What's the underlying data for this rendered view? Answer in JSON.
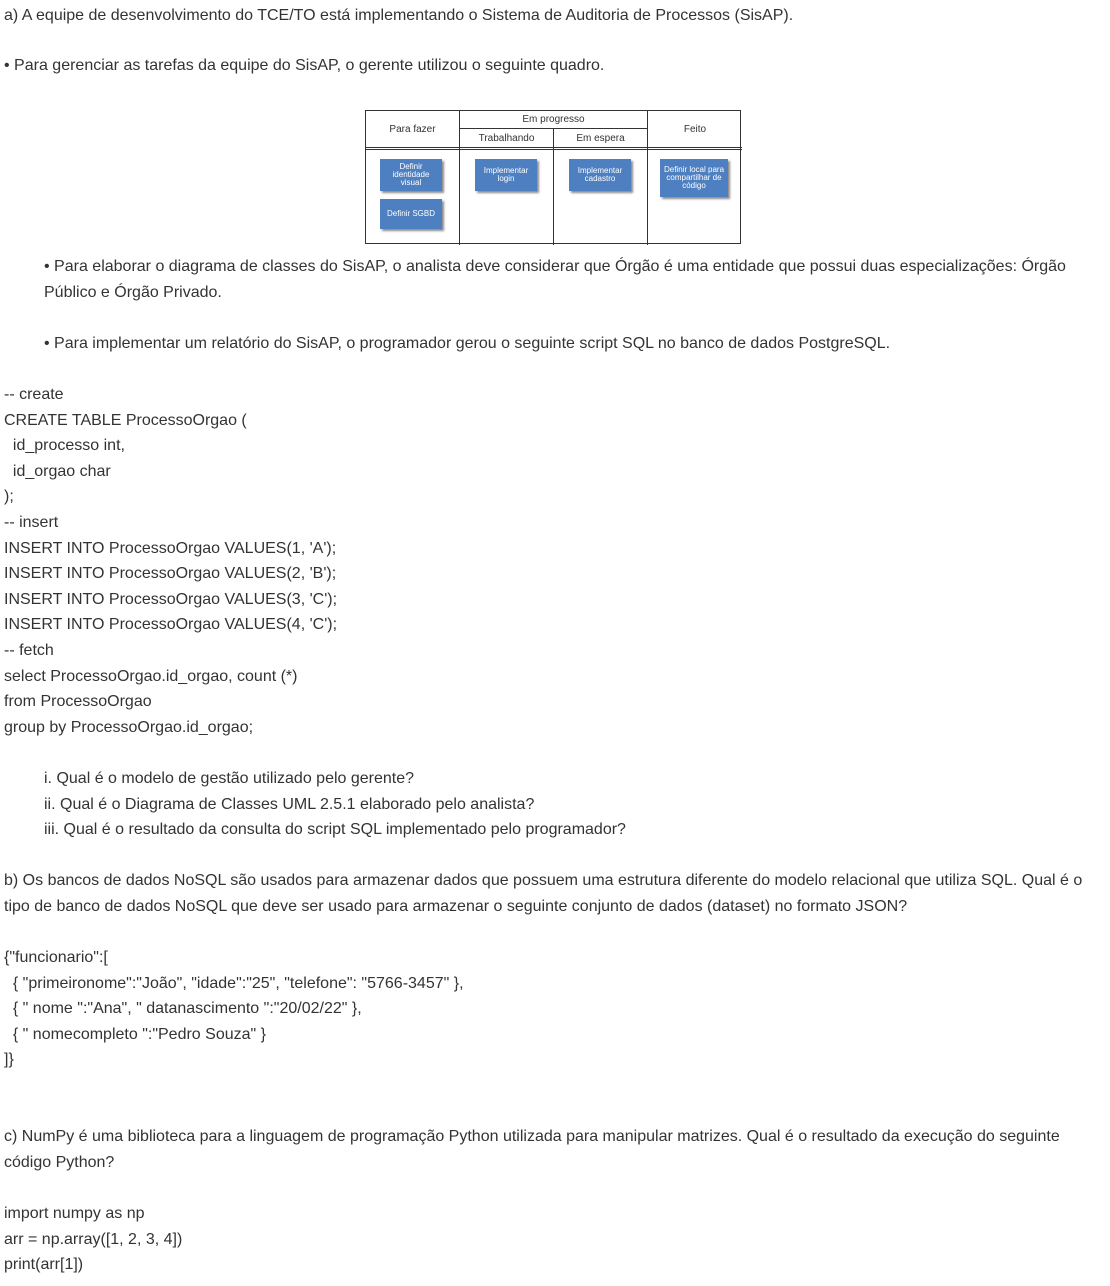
{
  "intro": {
    "a_line": "a) A equipe de desenvolvimento do TCE/TO está implementando o Sistema de Auditoria de Processos (SisAP).",
    "bullet_board": "• Para gerenciar as tarefas da equipe do SisAP, o gerente utilizou o seguinte quadro."
  },
  "board": {
    "col_todo": "Para fazer",
    "col_progress": "Em progresso",
    "col_working": "Trabalhando",
    "col_waiting": "Em espera",
    "col_done": "Feito",
    "card_colors": "#4e7fc0",
    "cards": {
      "todo_1": "Definir identidade visual",
      "todo_2": "Definir SGBD",
      "working_1": "Implementar login",
      "waiting_1": "Implementar cadastro",
      "done_1": "Definir local para compartilhar de código"
    }
  },
  "bullets": {
    "classes": "• Para elaborar o diagrama de classes do SisAP, o analista deve considerar que Órgão é uma entidade que possui duas especializações: Órgão Público e Órgão Privado.",
    "sql": "• Para implementar um relatório do SisAP, o programador gerou o seguinte script SQL no banco de dados PostgreSQL."
  },
  "sql_code": [
    "-- create",
    "CREATE TABLE ProcessoOrgao (",
    "  id_processo int,",
    "  id_orgao char",
    ");",
    "-- insert",
    "INSERT INTO ProcessoOrgao VALUES(1, 'A');",
    "INSERT INTO ProcessoOrgao VALUES(2, 'B');",
    "INSERT INTO ProcessoOrgao VALUES(3, 'C');",
    "INSERT INTO ProcessoOrgao VALUES(4, 'C');",
    "-- fetch",
    "select ProcessoOrgao.id_orgao, count (*)",
    "from ProcessoOrgao",
    "group by ProcessoOrgao.id_orgao;"
  ],
  "questions": [
    "i. Qual é o modelo de gestão utilizado pelo gerente?",
    "ii. Qual é o Diagrama de Classes UML 2.5.1 elaborado pelo analista?",
    "iii. Qual é o resultado da consulta do script SQL implementado pelo programador?"
  ],
  "part_b": "b) Os bancos de dados NoSQL são usados para armazenar dados que possuem uma estrutura diferente do modelo relacional que utiliza SQL. Qual é o tipo de banco de dados NoSQL que deve ser usado para armazenar o seguinte conjunto de dados (dataset) no formato JSON?",
  "json_code": [
    "{\"funcionario\":[",
    "  { \"primeironome\":\"João\", \"idade\":\"25\", \"telefone\": \"5766-3457\" },",
    "  { \" nome \":\"Ana\", \" datanascimento \":\"20/02/22\" },",
    "  { \" nomecompleto \":\"Pedro Souza\" }",
    "]}"
  ],
  "part_c": "c) NumPy é uma biblioteca para a linguagem de programação Python utilizada para manipular matrizes. Qual é o resultado da execução do seguinte código Python?",
  "python_code": [
    "import numpy as np",
    "arr = np.array([1, 2, 3, 4])",
    "print(arr[1])"
  ]
}
